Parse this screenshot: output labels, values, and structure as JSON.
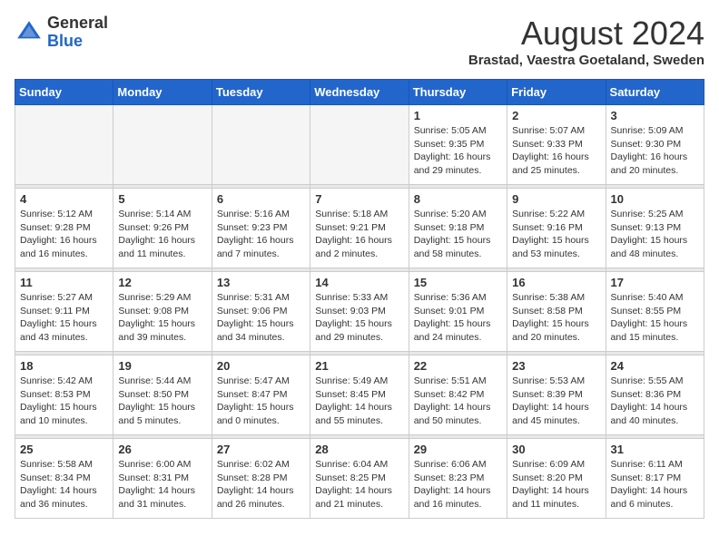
{
  "header": {
    "logo_general": "General",
    "logo_blue": "Blue",
    "month_title": "August 2024",
    "location": "Brastad, Vaestra Goetaland, Sweden"
  },
  "weekdays": [
    "Sunday",
    "Monday",
    "Tuesday",
    "Wednesday",
    "Thursday",
    "Friday",
    "Saturday"
  ],
  "weeks": [
    [
      {
        "day": "",
        "info": ""
      },
      {
        "day": "",
        "info": ""
      },
      {
        "day": "",
        "info": ""
      },
      {
        "day": "",
        "info": ""
      },
      {
        "day": "1",
        "info": "Sunrise: 5:05 AM\nSunset: 9:35 PM\nDaylight: 16 hours\nand 29 minutes."
      },
      {
        "day": "2",
        "info": "Sunrise: 5:07 AM\nSunset: 9:33 PM\nDaylight: 16 hours\nand 25 minutes."
      },
      {
        "day": "3",
        "info": "Sunrise: 5:09 AM\nSunset: 9:30 PM\nDaylight: 16 hours\nand 20 minutes."
      }
    ],
    [
      {
        "day": "4",
        "info": "Sunrise: 5:12 AM\nSunset: 9:28 PM\nDaylight: 16 hours\nand 16 minutes."
      },
      {
        "day": "5",
        "info": "Sunrise: 5:14 AM\nSunset: 9:26 PM\nDaylight: 16 hours\nand 11 minutes."
      },
      {
        "day": "6",
        "info": "Sunrise: 5:16 AM\nSunset: 9:23 PM\nDaylight: 16 hours\nand 7 minutes."
      },
      {
        "day": "7",
        "info": "Sunrise: 5:18 AM\nSunset: 9:21 PM\nDaylight: 16 hours\nand 2 minutes."
      },
      {
        "day": "8",
        "info": "Sunrise: 5:20 AM\nSunset: 9:18 PM\nDaylight: 15 hours\nand 58 minutes."
      },
      {
        "day": "9",
        "info": "Sunrise: 5:22 AM\nSunset: 9:16 PM\nDaylight: 15 hours\nand 53 minutes."
      },
      {
        "day": "10",
        "info": "Sunrise: 5:25 AM\nSunset: 9:13 PM\nDaylight: 15 hours\nand 48 minutes."
      }
    ],
    [
      {
        "day": "11",
        "info": "Sunrise: 5:27 AM\nSunset: 9:11 PM\nDaylight: 15 hours\nand 43 minutes."
      },
      {
        "day": "12",
        "info": "Sunrise: 5:29 AM\nSunset: 9:08 PM\nDaylight: 15 hours\nand 39 minutes."
      },
      {
        "day": "13",
        "info": "Sunrise: 5:31 AM\nSunset: 9:06 PM\nDaylight: 15 hours\nand 34 minutes."
      },
      {
        "day": "14",
        "info": "Sunrise: 5:33 AM\nSunset: 9:03 PM\nDaylight: 15 hours\nand 29 minutes."
      },
      {
        "day": "15",
        "info": "Sunrise: 5:36 AM\nSunset: 9:01 PM\nDaylight: 15 hours\nand 24 minutes."
      },
      {
        "day": "16",
        "info": "Sunrise: 5:38 AM\nSunset: 8:58 PM\nDaylight: 15 hours\nand 20 minutes."
      },
      {
        "day": "17",
        "info": "Sunrise: 5:40 AM\nSunset: 8:55 PM\nDaylight: 15 hours\nand 15 minutes."
      }
    ],
    [
      {
        "day": "18",
        "info": "Sunrise: 5:42 AM\nSunset: 8:53 PM\nDaylight: 15 hours\nand 10 minutes."
      },
      {
        "day": "19",
        "info": "Sunrise: 5:44 AM\nSunset: 8:50 PM\nDaylight: 15 hours\nand 5 minutes."
      },
      {
        "day": "20",
        "info": "Sunrise: 5:47 AM\nSunset: 8:47 PM\nDaylight: 15 hours\nand 0 minutes."
      },
      {
        "day": "21",
        "info": "Sunrise: 5:49 AM\nSunset: 8:45 PM\nDaylight: 14 hours\nand 55 minutes."
      },
      {
        "day": "22",
        "info": "Sunrise: 5:51 AM\nSunset: 8:42 PM\nDaylight: 14 hours\nand 50 minutes."
      },
      {
        "day": "23",
        "info": "Sunrise: 5:53 AM\nSunset: 8:39 PM\nDaylight: 14 hours\nand 45 minutes."
      },
      {
        "day": "24",
        "info": "Sunrise: 5:55 AM\nSunset: 8:36 PM\nDaylight: 14 hours\nand 40 minutes."
      }
    ],
    [
      {
        "day": "25",
        "info": "Sunrise: 5:58 AM\nSunset: 8:34 PM\nDaylight: 14 hours\nand 36 minutes."
      },
      {
        "day": "26",
        "info": "Sunrise: 6:00 AM\nSunset: 8:31 PM\nDaylight: 14 hours\nand 31 minutes."
      },
      {
        "day": "27",
        "info": "Sunrise: 6:02 AM\nSunset: 8:28 PM\nDaylight: 14 hours\nand 26 minutes."
      },
      {
        "day": "28",
        "info": "Sunrise: 6:04 AM\nSunset: 8:25 PM\nDaylight: 14 hours\nand 21 minutes."
      },
      {
        "day": "29",
        "info": "Sunrise: 6:06 AM\nSunset: 8:23 PM\nDaylight: 14 hours\nand 16 minutes."
      },
      {
        "day": "30",
        "info": "Sunrise: 6:09 AM\nSunset: 8:20 PM\nDaylight: 14 hours\nand 11 minutes."
      },
      {
        "day": "31",
        "info": "Sunrise: 6:11 AM\nSunset: 8:17 PM\nDaylight: 14 hours\nand 6 minutes."
      }
    ]
  ]
}
